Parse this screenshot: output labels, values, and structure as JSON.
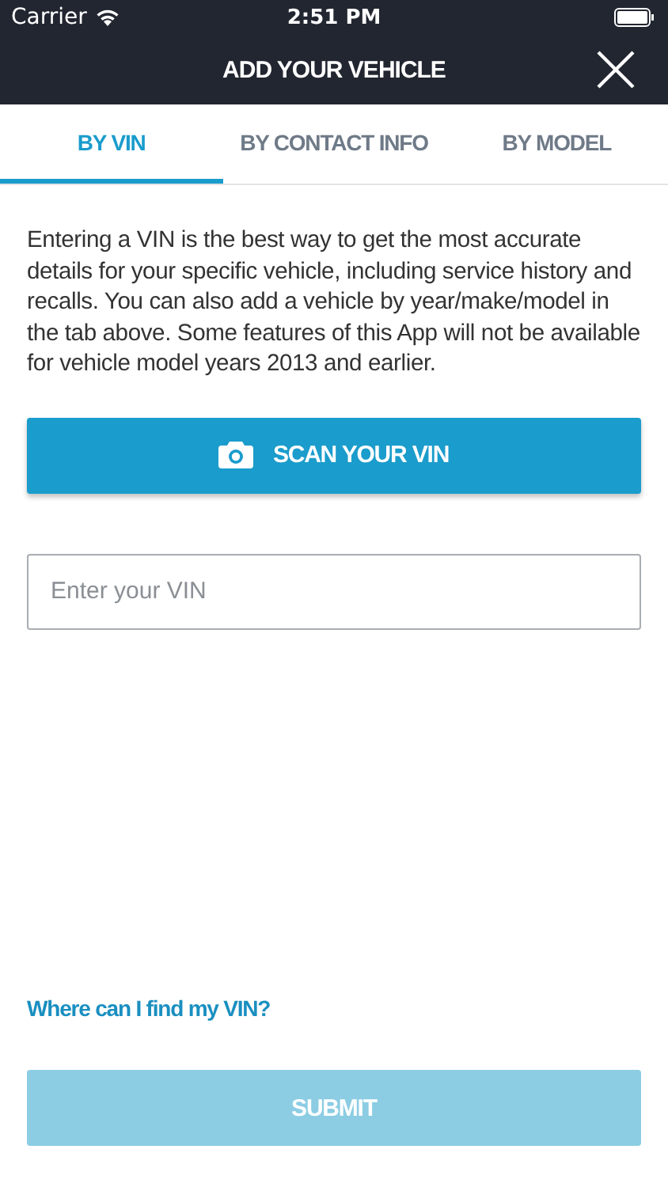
{
  "status_bar": {
    "carrier": "Carrier",
    "time": "2:51 PM"
  },
  "nav": {
    "title": "ADD YOUR VEHICLE"
  },
  "tabs": [
    {
      "label": "BY VIN",
      "selected": true
    },
    {
      "label": "BY CONTACT INFO",
      "selected": false
    },
    {
      "label": "BY MODEL",
      "selected": false
    }
  ],
  "intro": "Entering a VIN is the best way to get the most accurate details for your specific vehicle, including service history and recalls. You can also add a vehicle by year/make/model in the tab above. Some features of this App will not be available for vehicle model years 2013 and earlier.",
  "scan_button": "SCAN YOUR VIN",
  "vin_field": {
    "placeholder": "Enter your VIN"
  },
  "help_link": "Where can I find my VIN?",
  "submit": {
    "label": "SUBMIT",
    "disabled": true
  }
}
